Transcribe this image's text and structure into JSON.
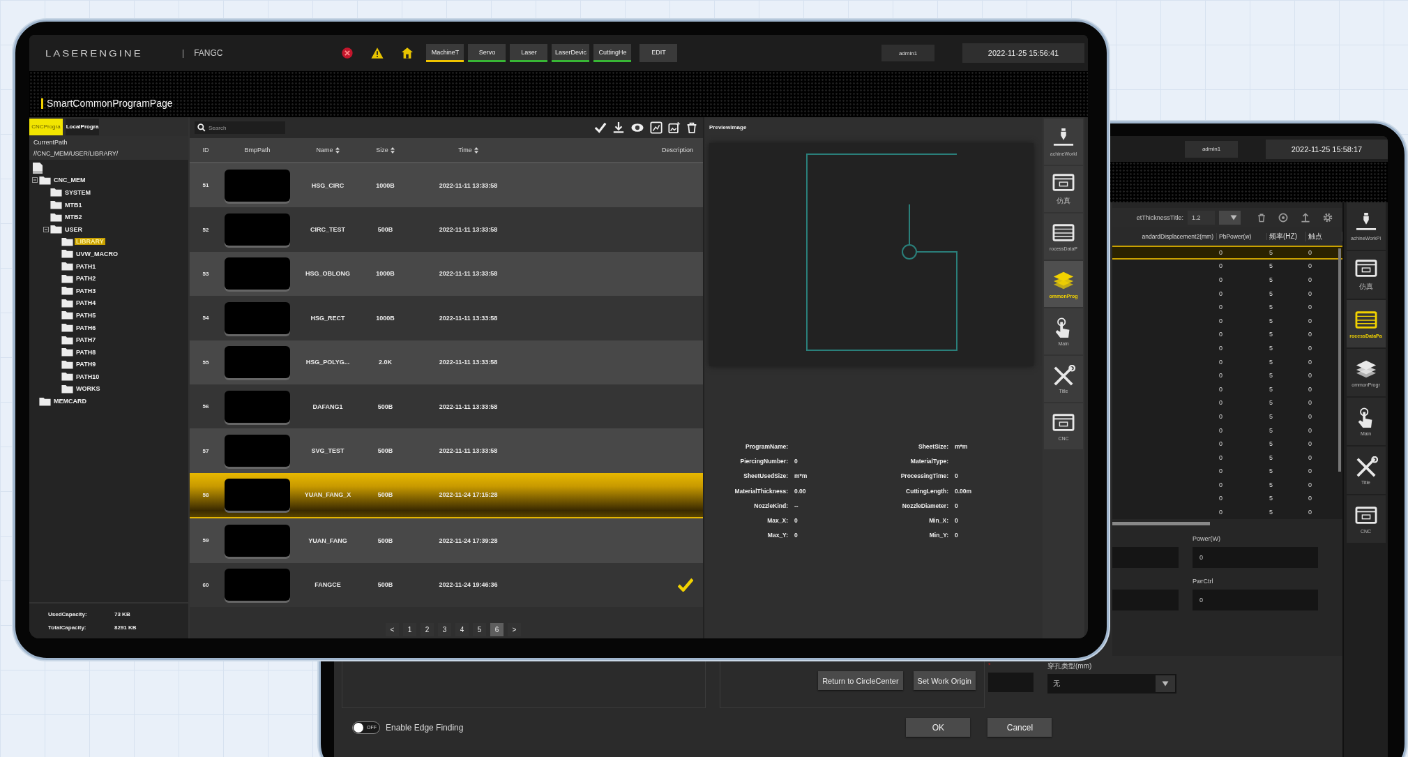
{
  "front_tablet": {
    "topbar": {
      "logo": "LASERENGINE",
      "separator": "|",
      "machine": "FANGC",
      "tabs": [
        {
          "label": "MachineT",
          "kind": "module",
          "selected": true
        },
        {
          "label": "Servo",
          "kind": "module",
          "selected": false
        },
        {
          "label": "Laser",
          "kind": "module",
          "selected": false
        },
        {
          "label": "LaserDevic",
          "kind": "module",
          "selected": false
        },
        {
          "label": "CuttingHe",
          "kind": "module",
          "selected": false
        },
        {
          "label": "EDIT",
          "kind": "action",
          "selected": false
        }
      ],
      "user": "admin1",
      "datetime": "2022-11-25 15:56:41"
    },
    "page_title": "SmartCommonProgramPage",
    "sidebar": {
      "tabs": [
        {
          "label": "CNCProgra",
          "selected": true
        },
        {
          "label": "LocalProgra",
          "selected": false
        }
      ],
      "path_label": "CurrentPath",
      "path": "//CNC_MEM/USER/LIBRARY/",
      "tree": [
        {
          "label": "CNC_MEM",
          "selected": false,
          "children": [
            {
              "label": "SYSTEM",
              "selected": false
            },
            {
              "label": "MTB1",
              "selected": false
            },
            {
              "label": "MTB2",
              "selected": false
            },
            {
              "label": "USER",
              "selected": false,
              "children": [
                {
                  "label": "LIBRARY",
                  "selected": true
                },
                {
                  "label": "UVW_MACRO",
                  "selected": false
                },
                {
                  "label": "PATH1",
                  "selected": false
                },
                {
                  "label": "PATH2",
                  "selected": false
                },
                {
                  "label": "PATH3",
                  "selected": false
                },
                {
                  "label": "PATH4",
                  "selected": false
                },
                {
                  "label": "PATH5",
                  "selected": false
                },
                {
                  "label": "PATH6",
                  "selected": false
                },
                {
                  "label": "PATH7",
                  "selected": false
                },
                {
                  "label": "PATH8",
                  "selected": false
                },
                {
                  "label": "PATH9",
                  "selected": false
                },
                {
                  "label": "PATH10",
                  "selected": false
                },
                {
                  "label": "WORKS",
                  "selected": false
                }
              ]
            }
          ]
        },
        {
          "label": "MEMCARD",
          "selected": false
        }
      ],
      "capacity": [
        {
          "label": "UsedCapacity:",
          "value": "73 KB"
        },
        {
          "label": "TotalCapacity:",
          "value": "8291 KB"
        }
      ]
    },
    "program_table": {
      "search": {
        "placeholder": "Search"
      },
      "columns": [
        {
          "label": "ID",
          "sortable": false
        },
        {
          "label": "BmpPath",
          "sortable": false
        },
        {
          "label": "Name",
          "sortable": true
        },
        {
          "label": "Size",
          "sortable": true
        },
        {
          "label": "Time",
          "sortable": true
        },
        {
          "label": "Description",
          "sortable": false
        }
      ],
      "rows": [
        {
          "id": "51",
          "name": "HSG_CIRC",
          "size": "1000B",
          "time": "2022-11-11 13:33:58",
          "selected": false,
          "checked": false
        },
        {
          "id": "52",
          "name": "CIRC_TEST",
          "size": "500B",
          "time": "2022-11-11 13:33:58",
          "selected": false,
          "checked": false
        },
        {
          "id": "53",
          "name": "HSG_OBLONG",
          "size": "1000B",
          "time": "2022-11-11 13:33:58",
          "selected": false,
          "checked": false
        },
        {
          "id": "54",
          "name": "HSG_RECT",
          "size": "1000B",
          "time": "2022-11-11 13:33:58",
          "selected": false,
          "checked": false
        },
        {
          "id": "55",
          "name": "HSG_POLYG...",
          "size": "2.0K",
          "time": "2022-11-11 13:33:58",
          "selected": false,
          "checked": false
        },
        {
          "id": "56",
          "name": "DAFANG1",
          "size": "500B",
          "time": "2022-11-11 13:33:58",
          "selected": false,
          "checked": false
        },
        {
          "id": "57",
          "name": "SVG_TEST",
          "size": "500B",
          "time": "2022-11-11 13:33:58",
          "selected": false,
          "checked": false
        },
        {
          "id": "58",
          "name": "YUAN_FANG_X",
          "size": "500B",
          "time": "2022-11-24 17:15:28",
          "selected": true,
          "checked": false
        },
        {
          "id": "59",
          "name": "YUAN_FANG",
          "size": "500B",
          "time": "2022-11-24 17:39:28",
          "selected": false,
          "checked": false
        },
        {
          "id": "60",
          "name": "FANGCE",
          "size": "500B",
          "time": "2022-11-24 19:46:36",
          "selected": false,
          "checked": true
        }
      ],
      "pagination": {
        "prev": "<",
        "next": ">",
        "pages": [
          {
            "label": "1",
            "selected": false
          },
          {
            "label": "2",
            "selected": false
          },
          {
            "label": "3",
            "selected": false
          },
          {
            "label": "4",
            "selected": false
          },
          {
            "label": "5",
            "selected": false
          },
          {
            "label": "6",
            "selected": true
          }
        ]
      }
    },
    "preview": {
      "title": "PreviewImage",
      "fields": [
        {
          "label": "ProgramName:"
        },
        {
          "label": "SheetSize:",
          "value": "m*m"
        },
        {
          "label": "PiercingNumber:",
          "value": "0"
        },
        {
          "label": "MaterialType:"
        },
        {
          "label": "SheetUsedSize:",
          "value": "m*m"
        },
        {
          "label": "ProcessingTime:",
          "value": "0"
        },
        {
          "label": "MaterialThickness:",
          "value": "0.00"
        },
        {
          "label": "CuttingLength:",
          "value": "0.00m"
        },
        {
          "label": "NozzleKind:",
          "value": "--"
        },
        {
          "label": "NozzleDiameter:",
          "value": "0"
        },
        {
          "label": "Max_X:",
          "value": "0"
        },
        {
          "label": "Min_X:",
          "value": "0"
        },
        {
          "label": "Max_Y:",
          "value": "0"
        },
        {
          "label": "Min_Y:",
          "value": "0"
        }
      ]
    },
    "nav": [
      {
        "label": "achineWorkl",
        "kind": "machine",
        "selected": false
      },
      {
        "label": "仿真",
        "kind": "window",
        "selected": false
      },
      {
        "label": "rocessDataP",
        "kind": "table",
        "selected": false
      },
      {
        "label": "ommonProg",
        "kind": "layers",
        "selected": true
      },
      {
        "label": "Main",
        "kind": "touch",
        "selected": false
      },
      {
        "label": "Title",
        "kind": "tools",
        "selected": false
      },
      {
        "label": "CNC",
        "kind": "window",
        "selected": false
      }
    ]
  },
  "back_tablet": {
    "topbar": {
      "user": "admin1",
      "datetime": "2022-11-25 15:58:17"
    },
    "thickness": {
      "label": "etThicknessTitle:",
      "value": "1.2"
    },
    "table": {
      "columns": [
        "andardDisplacement2(mm)",
        "PbPower(w)",
        "频率(HZ)",
        "触点"
      ],
      "rows": [
        {
          "values": [
            "0",
            "5",
            "0"
          ],
          "selected": true
        },
        {
          "values": [
            "0",
            "5",
            "0"
          ],
          "selected": false
        },
        {
          "values": [
            "0",
            "5",
            "0"
          ],
          "selected": false
        },
        {
          "values": [
            "0",
            "5",
            "0"
          ],
          "selected": false
        },
        {
          "values": [
            "0",
            "5",
            "0"
          ],
          "selected": false
        },
        {
          "values": [
            "0",
            "5",
            "0"
          ],
          "selected": false
        },
        {
          "values": [
            "0",
            "5",
            "0"
          ],
          "selected": false
        },
        {
          "values": [
            "0",
            "5",
            "0"
          ],
          "selected": false
        },
        {
          "values": [
            "0",
            "5",
            "0"
          ],
          "selected": false
        },
        {
          "values": [
            "0",
            "5",
            "0"
          ],
          "selected": false
        },
        {
          "values": [
            "0",
            "5",
            "0"
          ],
          "selected": false
        },
        {
          "values": [
            "0",
            "5",
            "0"
          ],
          "selected": false
        },
        {
          "values": [
            "0",
            "5",
            "0"
          ],
          "selected": false
        },
        {
          "values": [
            "0",
            "5",
            "0"
          ],
          "selected": false
        },
        {
          "values": [
            "0",
            "5",
            "0"
          ],
          "selected": false
        },
        {
          "values": [
            "0",
            "5",
            "0"
          ],
          "selected": false
        },
        {
          "values": [
            "0",
            "5",
            "0"
          ],
          "selected": false
        },
        {
          "values": [
            "0",
            "5",
            "0"
          ],
          "selected": false
        },
        {
          "values": [
            "0",
            "5",
            "0"
          ],
          "selected": false
        },
        {
          "values": [
            "0",
            "5",
            "0"
          ],
          "selected": false
        }
      ]
    },
    "form": [
      {
        "label": "Power(W)",
        "value": "0"
      },
      {
        "label": "PwrCtrl",
        "value": "0"
      }
    ],
    "actions": [
      "Return to CircleCenter",
      "Set Work Origin"
    ],
    "required_mark": "*",
    "hole_type": {
      "label": "穿孔类型(mm)",
      "value": "无"
    },
    "edge_toggle": {
      "on": false,
      "state_text": "OFF",
      "label": "Enable Edge Finding"
    },
    "dialog_buttons": [
      "OK",
      "Cancel"
    ],
    "nav": [
      {
        "label": "achineWorkPi",
        "kind": "machine",
        "selected": false
      },
      {
        "label": "仿真",
        "kind": "window",
        "selected": false
      },
      {
        "label": "rocessDataPa",
        "kind": "table",
        "selected": true
      },
      {
        "label": "ommonProgr",
        "kind": "layers",
        "selected": false
      },
      {
        "label": "Main",
        "kind": "touch",
        "selected": false
      },
      {
        "label": "Title",
        "kind": "tools",
        "selected": false
      },
      {
        "label": "CNC",
        "kind": "window",
        "selected": false
      }
    ]
  }
}
